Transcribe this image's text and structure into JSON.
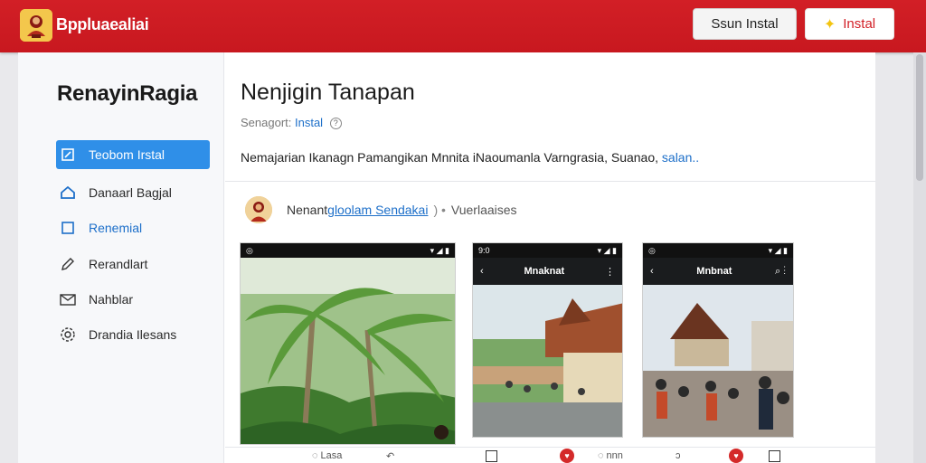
{
  "app": {
    "title": "Bppluaealiai",
    "install_secondary_label": "Ssun Instal",
    "install_primary_label": "Instal",
    "brand_color": "#d21f26",
    "accent_color": "#2f8fe8"
  },
  "sidebar": {
    "title": "RenayinRagia",
    "items": [
      {
        "label": "Teobom Irstal",
        "icon": "edit-icon",
        "active": true
      },
      {
        "label": "Danaarl Bagjal",
        "icon": "home-icon"
      },
      {
        "label": "Renemial",
        "icon": "square-icon"
      },
      {
        "label": "Rerandlart",
        "icon": "pencil-icon"
      },
      {
        "label": "Nahblar",
        "icon": "mail-icon"
      },
      {
        "label": "Drandia Ilesans",
        "icon": "gear-icon"
      }
    ]
  },
  "main": {
    "title": "Nenjigin Tanapan",
    "meta_label": "Senagort:",
    "meta_link": "Instal",
    "description": "Nemajarian Ikanagn Pamangikan Mnnita iNaoumanla Varngrasia, Suanao,",
    "description_link": "salan..",
    "developer": {
      "name": "Nenant",
      "link": "gloolam Sendakai",
      "separator": ") •",
      "category": "Vuerlaaises"
    },
    "screenshots": [
      {
        "caption": "",
        "appbar_title": ""
      },
      {
        "caption": "",
        "appbar_title": "Mnaknat"
      },
      {
        "caption": "",
        "appbar_title": "Mnbnat"
      }
    ],
    "bottom_strip": {
      "item1": "Lasa",
      "item2": "nnn"
    }
  }
}
